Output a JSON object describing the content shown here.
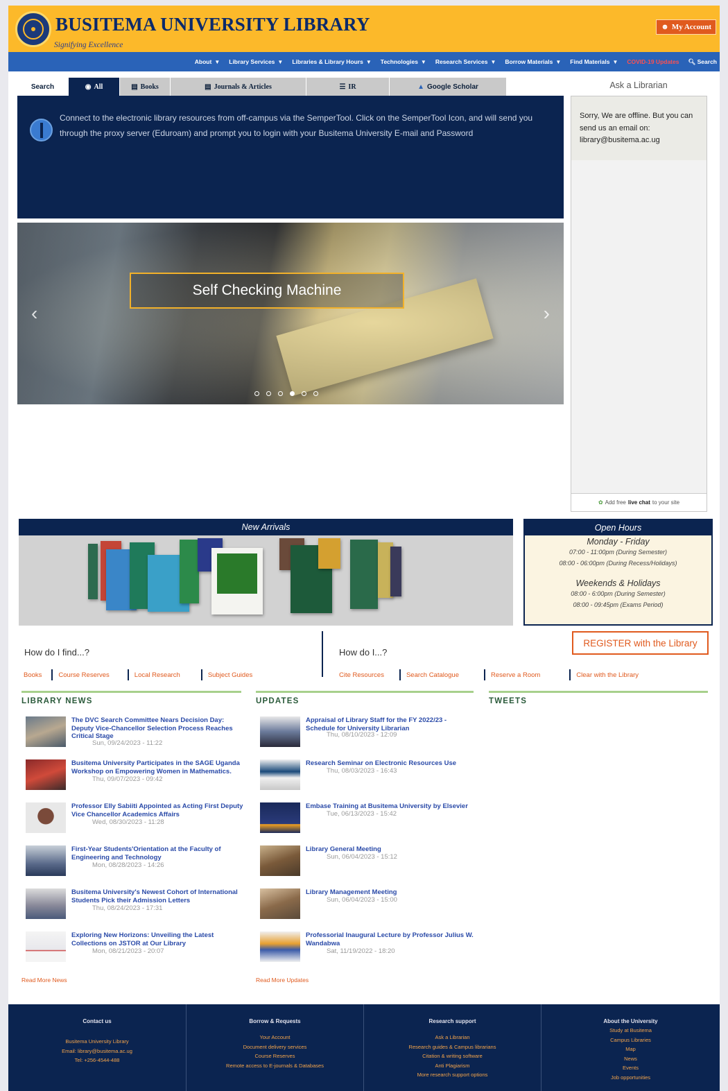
{
  "header": {
    "title": "BUSITEMA UNIVERSITY LIBRARY",
    "tagline": "Signifying Excellence",
    "account_label": "My Account"
  },
  "nav": {
    "items": [
      {
        "label": "About"
      },
      {
        "label": "Library Services"
      },
      {
        "label": "Libraries & Library Hours"
      },
      {
        "label": "Technologies"
      },
      {
        "label": "Research Services"
      },
      {
        "label": "Borrow Materials"
      },
      {
        "label": "Find Materials"
      }
    ],
    "covid_label": "COVID-19 Updates",
    "search_label": "Search"
  },
  "search": {
    "label": "Search",
    "tabs": [
      {
        "label": "All",
        "icon": "globe-icon"
      },
      {
        "label": "Books",
        "icon": "book-icon"
      },
      {
        "label": "Journals & Articles",
        "icon": "newspaper-icon"
      },
      {
        "label": "IR",
        "icon": "database-icon"
      },
      {
        "label": "Google Scholar",
        "icon": "scholar-icon"
      }
    ],
    "active_tab": "All",
    "panel_text": "Connect to the electronic library resources from off-campus via the SemperTool. Click on the SemperTool Icon, and will send you through the proxy server (Eduroam) and prompt you to login with your Busitema University E-mail and Password"
  },
  "carousel": {
    "caption": "Self Checking Machine",
    "slide_count": 6,
    "active_slide": 4
  },
  "ask": {
    "title": "Ask a Librarian",
    "message": "Sorry, We are offline. But you can send us an email on: library@busitema.ac.ug",
    "footer_prefix": "Add free",
    "footer_bold": "live chat",
    "footer_suffix": "to your site"
  },
  "arrivals": {
    "title": "New Arrivals"
  },
  "hours": {
    "title": "Open Hours",
    "weekday_label": "Monday - Friday",
    "weekday_lines": [
      "07:00 - 11:00pm (During Semester)",
      "08:00 - 06:00pm (During Recess/Holidays)"
    ],
    "weekend_label": "Weekends & Holidays",
    "weekend_lines": [
      "08:00 - 6:00pm (During Semester)",
      "08:00 - 09:45pm (Exams Period)"
    ]
  },
  "how_find": {
    "label": "How do I find...?",
    "links": [
      "Books",
      "Course Reserves",
      "Local Research",
      "Subject Guides"
    ]
  },
  "how_do": {
    "label": "How do I...?",
    "links": [
      "Cite Resources",
      "Search Catalogue",
      "Reserve a Room",
      "Clear with the Library"
    ]
  },
  "register": {
    "bold": "REGISTER",
    "rest": "with the Library"
  },
  "news": {
    "title": "LIBRARY NEWS",
    "read_more": "Read More News",
    "items": [
      {
        "title": "The DVC Search Committee Nears Decision Day: Deputy Vice-Chancellor Selection Process Reaches Critical Stage",
        "date": "Sun, 09/24/2023 - 11:22"
      },
      {
        "title": "Busitema University Participates in the SAGE Uganda Workshop on Empowering Women in Mathematics.",
        "date": "Thu, 09/07/2023 - 09:42"
      },
      {
        "title": "Professor Elly Sabiiti Appointed as Acting First Deputy Vice Chancellor Academics Affairs",
        "date": "Wed, 08/30/2023 - 11:28"
      },
      {
        "title": "First-Year Students'Orientation at the Faculty of Engineering and Technology",
        "date": "Mon, 08/28/2023 - 14:26"
      },
      {
        "title": "Busitema University's Newest Cohort of International Students Pick their Admission Letters",
        "date": "Thu, 08/24/2023 - 17:31"
      },
      {
        "title": "Exploring New Horizons: Unveiling the Latest Collections on JSTOR at Our Library",
        "date": "Mon, 08/21/2023 - 20:07"
      }
    ]
  },
  "updates": {
    "title": "UPDATES",
    "read_more": "Read More Updates",
    "items": [
      {
        "title": "Appraisal of Library Staff for the FY 2022/23 - Schedule for University Librarian",
        "date": "Thu, 08/10/2023 - 12:09"
      },
      {
        "title": "Research Seminar on Electronic Resources Use",
        "date": "Thu, 08/03/2023 - 16:43"
      },
      {
        "title": "Embase Training at Busitema University by Elsevier",
        "date": "Tue, 06/13/2023 - 15:42"
      },
      {
        "title": "Library General Meeting",
        "date": "Sun, 06/04/2023 - 15:12"
      },
      {
        "title": "Library Management Meeting",
        "date": "Sun, 06/04/2023 - 15:00"
      },
      {
        "title": "Professorial Inaugural Lecture by Professor Julius W. Wandabwa",
        "date": "Sat, 11/19/2022 - 18:20"
      }
    ]
  },
  "tweets": {
    "title": "TWEETS"
  },
  "footer": {
    "columns": [
      {
        "title": "Contact us",
        "lines": [
          "Busitema University Library",
          "Email: library@busitema.ac.ug",
          "Tel: +256-4544-488"
        ]
      },
      {
        "title": "Borrow & Requests",
        "lines": [
          "Your Account",
          "Document delivery services",
          "Course Reserves",
          "Remote access to E-journals & Databases"
        ]
      },
      {
        "title": "Research support",
        "lines": [
          "Ask a Librarian",
          "Research guides & Campus librarians",
          "Citation & writing software",
          "Anti Plagiarism",
          "More research support options"
        ]
      },
      {
        "title": "About the University",
        "lines": [
          "Study at Busitema",
          "Campus Libraries",
          "Map",
          "News",
          "Events",
          "Job opportunities"
        ]
      }
    ]
  },
  "colors": {
    "brand_yellow": "#fcb92a",
    "navy": "#0b2450",
    "nav_blue": "#2a63b8",
    "accent_orange": "#e05a1e",
    "link_blue": "#2a4aa8"
  }
}
